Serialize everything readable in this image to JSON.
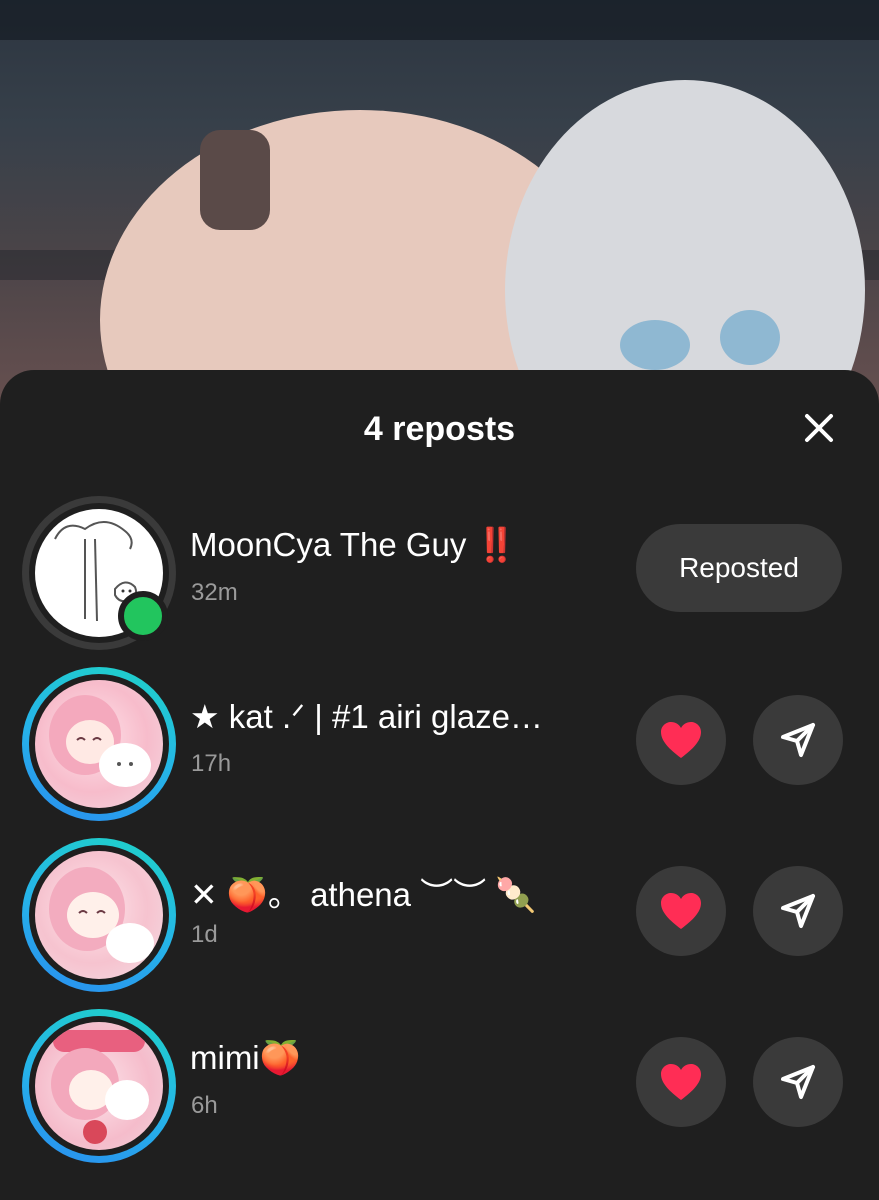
{
  "sheet": {
    "title": "4 reposts"
  },
  "reposts": [
    {
      "name": "MoonCya The Guy ‼️",
      "time": "32m",
      "action": "Reposted"
    },
    {
      "name": "★ kat .ᐟ | #1 airi glaze…",
      "time": "17h"
    },
    {
      "name": "✕ 🍑。 athena ︶︶ 🍡",
      "time": "1d"
    },
    {
      "name": "mimi🍑",
      "time": "6h"
    }
  ],
  "colors": {
    "sheet_bg": "#1f1f1f",
    "button_bg": "#3a3a3a",
    "online_green": "#22c55e",
    "heart_red": "#ff2d55",
    "story_ring": "#25b6e8",
    "muted_text": "#9a9a9a"
  }
}
